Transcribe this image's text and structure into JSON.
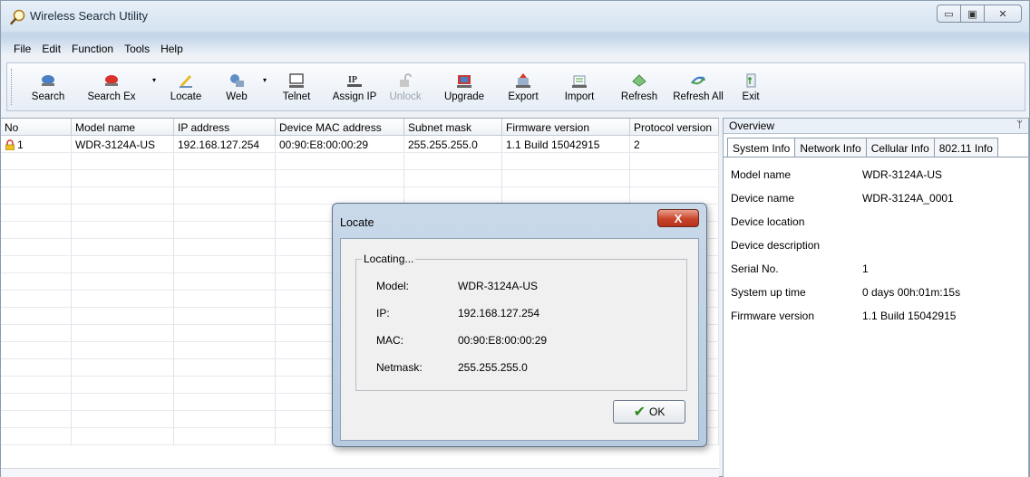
{
  "window": {
    "title": "Wireless Search Utility"
  },
  "caption": {
    "minimize": "▭",
    "maximize": "▣",
    "close": "✕"
  },
  "menu": {
    "items": [
      {
        "label": "File",
        "key": "F"
      },
      {
        "label": "Edit",
        "key": "E"
      },
      {
        "label": "Function",
        "key": "u"
      },
      {
        "label": "Tools",
        "key": "o"
      },
      {
        "label": "Help",
        "key": "H"
      }
    ]
  },
  "toolbar": {
    "buttons": [
      {
        "label": "Search",
        "icon": "search-icon"
      },
      {
        "label": "Search Ex",
        "icon": "search-ex-icon"
      },
      {
        "label": "Locate",
        "icon": "locate-icon"
      },
      {
        "label": "Web",
        "icon": "web-icon"
      },
      {
        "label": "Telnet",
        "icon": "telnet-icon"
      },
      {
        "label": "Assign IP",
        "icon": "assign-ip-icon"
      },
      {
        "label": "Unlock",
        "icon": "unlock-icon"
      },
      {
        "label": "Upgrade",
        "icon": "upgrade-icon"
      },
      {
        "label": "Export",
        "icon": "export-icon"
      },
      {
        "label": "Import",
        "icon": "import-icon"
      },
      {
        "label": "Refresh",
        "icon": "refresh-icon"
      },
      {
        "label": "Refresh All",
        "icon": "refresh-all-icon"
      },
      {
        "label": "Exit",
        "icon": "exit-icon"
      }
    ],
    "dropdown_arrow": "▾"
  },
  "grid": {
    "columns": [
      "No",
      "Model name",
      "IP address",
      "Device MAC address",
      "Subnet mask",
      "Firmware version",
      "Protocol version"
    ],
    "rows": [
      [
        "1",
        "WDR-3124A-US",
        "192.168.127.254",
        "00:90:E8:00:00:29",
        "255.255.255.0",
        "1.1 Build 15042915",
        "2"
      ]
    ]
  },
  "overview": {
    "title": "Overview",
    "pin": "ᛘ",
    "tabs": [
      "System Info",
      "Network Info",
      "Cellular Info",
      "802.11 Info"
    ],
    "rows": [
      {
        "key": "Model name",
        "value": "WDR-3124A-US"
      },
      {
        "key": "Device name",
        "value": "WDR-3124A_0001"
      },
      {
        "key": "Device location",
        "value": ""
      },
      {
        "key": "Device description",
        "value": ""
      },
      {
        "key": "Serial No.",
        "value": "1"
      },
      {
        "key": "System up time",
        "value": "0 days 00h:01m:15s"
      },
      {
        "key": "Firmware version",
        "value": "1.1 Build 15042915"
      }
    ]
  },
  "dialog": {
    "title": "Locate",
    "close": "X",
    "group_label": "Locating...",
    "fields": [
      {
        "key": "Model:",
        "value": "WDR-3124A-US"
      },
      {
        "key": "IP:",
        "value": "192.168.127.254"
      },
      {
        "key": "MAC:",
        "value": "00:90:E8:00:00:29"
      },
      {
        "key": "Netmask:",
        "value": "255.255.255.0"
      }
    ],
    "ok_label": "OK",
    "ok_icon": "✔"
  }
}
